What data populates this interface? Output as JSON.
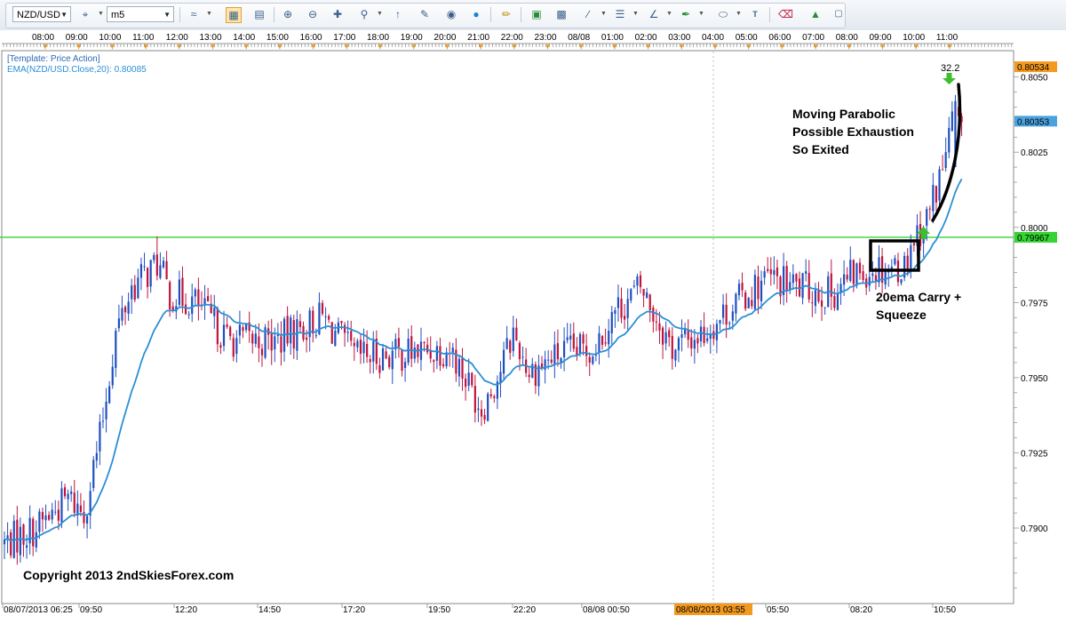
{
  "toolbar": {
    "symbol": "NZD/USD",
    "timeframe": "m5",
    "icons": [
      "line-chart-icon",
      "candle-chart-icon",
      "bar-chart-icon",
      "zoom-in-icon",
      "zoom-out-icon",
      "crosshair-icon",
      "magnifier-icon",
      "cursor-icon",
      "template-icon",
      "indicator-icon",
      "globe-icon",
      "ruler-icon",
      "picture-icon",
      "screenshot-icon",
      "trendline-icon",
      "horizontal-line-icon",
      "fib-icon",
      "pen-icon",
      "ellipse-icon",
      "text-icon",
      "eraser-icon",
      "object-tree-icon",
      "window-icon"
    ]
  },
  "chart_data": {
    "type": "candlestick",
    "symbol": "NZD/USD",
    "timeframe": "m5",
    "template_label": "[Template: Price Action]",
    "ema_label": "EMA(NZD/USD.Close,20): 0.80085",
    "ylim": [
      0.788,
      0.8055
    ],
    "y_ticks": [
      "0.8050",
      "0.8025",
      "0.8000",
      "0.7975",
      "0.7950",
      "0.7925",
      "0.7900"
    ],
    "top_time_labels": [
      "08:00",
      "09:00",
      "10:00",
      "11:00",
      "12:00",
      "13:00",
      "14:00",
      "15:00",
      "16:00",
      "17:00",
      "18:00",
      "19:00",
      "20:00",
      "21:00",
      "22:00",
      "23:00",
      "08/08",
      "01:00",
      "02:00",
      "03:00",
      "04:00",
      "05:00",
      "06:00",
      "07:00",
      "08:00",
      "09:00",
      "10:00",
      "11:00"
    ],
    "bottom_time_labels": [
      "08/07/2013 06:25",
      "09:50",
      "12:20",
      "14:50",
      "17:20",
      "19:50",
      "22:20",
      "08/08 00:50",
      "08/08/2013 03:55",
      "05:50",
      "08:20",
      "10:50"
    ],
    "highlighted_time": "08/08/2013 03:55",
    "price_tags": [
      {
        "value": "0.80534",
        "color": "#f39a1e"
      },
      {
        "value": "0.80353",
        "color": "#4aa3df"
      },
      {
        "value": "0.79967",
        "color": "#33d433"
      }
    ],
    "horizontal_level": 0.79967,
    "price_waypoints": [
      [
        0,
        0.7895
      ],
      [
        10,
        0.79
      ],
      [
        20,
        0.791
      ],
      [
        25,
        0.7905
      ],
      [
        30,
        0.793
      ],
      [
        35,
        0.7965
      ],
      [
        40,
        0.798
      ],
      [
        45,
        0.7985
      ],
      [
        48,
        0.7988
      ],
      [
        52,
        0.7978
      ],
      [
        60,
        0.7975
      ],
      [
        70,
        0.7963
      ],
      [
        85,
        0.7962
      ],
      [
        100,
        0.797
      ],
      [
        110,
        0.7957
      ],
      [
        125,
        0.7958
      ],
      [
        140,
        0.796
      ],
      [
        145,
        0.795
      ],
      [
        150,
        0.794
      ],
      [
        155,
        0.795
      ],
      [
        160,
        0.7965
      ],
      [
        165,
        0.7952
      ],
      [
        175,
        0.7958
      ],
      [
        185,
        0.796
      ],
      [
        192,
        0.7972
      ],
      [
        200,
        0.798
      ],
      [
        205,
        0.797
      ],
      [
        210,
        0.796
      ],
      [
        220,
        0.7965
      ],
      [
        230,
        0.7975
      ],
      [
        240,
        0.7983
      ],
      [
        250,
        0.798
      ],
      [
        260,
        0.7978
      ],
      [
        268,
        0.7985
      ],
      [
        275,
        0.7987
      ],
      [
        283,
        0.7987
      ],
      [
        285,
        0.7995
      ],
      [
        290,
        0.8003
      ],
      [
        295,
        0.802
      ],
      [
        299,
        0.804
      ],
      [
        301,
        0.8038
      ]
    ],
    "annotations": [
      {
        "text": "Moving Parabolic",
        "kind": "note"
      },
      {
        "text": "Possible Exhaustion",
        "kind": "note"
      },
      {
        "text": "So Exited",
        "kind": "note"
      },
      {
        "text": "20ema Carry +",
        "kind": "note"
      },
      {
        "text": "Squeeze",
        "kind": "note"
      },
      {
        "text": "32.2",
        "kind": "value"
      },
      {
        "text": "Copyright 2013 2ndSkiesForex.com",
        "kind": "copyright"
      }
    ],
    "colors": {
      "up": "#1f4fbf",
      "down": "#c0143c",
      "ema": "#2b8fd6",
      "level": "#33d433",
      "tick": "#f39a1e"
    }
  }
}
